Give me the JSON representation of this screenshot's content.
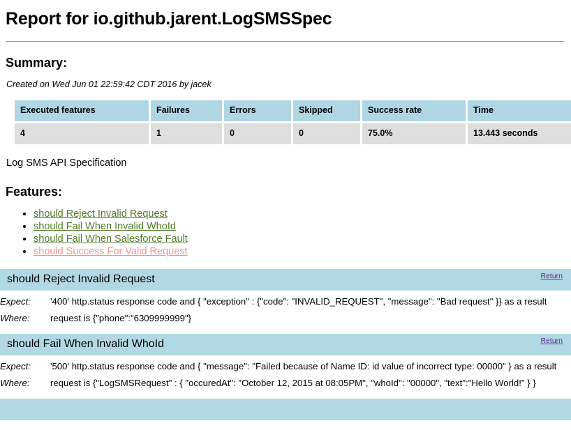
{
  "title": "Report for io.github.jarent.LogSMSSpec",
  "summary": {
    "heading": "Summary:",
    "created": "Created on Wed Jun 01 22:59:42 CDT 2016 by jacek",
    "table": {
      "headers": [
        "Executed features",
        "Failures",
        "Errors",
        "Skipped",
        "Success rate",
        "Time"
      ],
      "row": [
        "4",
        "1",
        "0",
        "0",
        "75.0%",
        "13.443 seconds"
      ]
    }
  },
  "spec_name": "Log SMS API Specification",
  "features": {
    "heading": "Features:",
    "items": [
      {
        "label": "should Reject Invalid Request",
        "status": "pass"
      },
      {
        "label": "should Fail When Invalid WhoId",
        "status": "pass"
      },
      {
        "label": "should Fail When Salesforce Fault",
        "status": "pass"
      },
      {
        "label": "should Success For Valid Request",
        "status": "fail"
      }
    ]
  },
  "return_label": "Return",
  "labels": {
    "expect": "Expect:",
    "where": "Where:"
  },
  "blocks": [
    {
      "title": "should Reject Invalid Request",
      "expect": "'400' http.status response code and { \"exception\" : {\"code\": \"INVALID_REQUEST\", \"message\": \"Bad request\" }} as a result",
      "where": "request is {\"phone\":\"6309999999\"}"
    },
    {
      "title": "should Fail When Invalid WhoId",
      "expect": "'500' http.status response code and { \"message\": \"Failed because of Name ID: id value of incorrect type: 00000\" } as a result",
      "where": "request is {\"LogSMSRequest\" : { \"occuredAt\": \"October 12, 2015 at 08:05PM\", \"whoId\": \"00000\", \"text\":\"Hello World!\" } }"
    },
    {
      "title": "",
      "expect": "",
      "where": ""
    }
  ],
  "colors": {
    "table_header_bg": "#aed6e3",
    "table_row_bg": "#dedede",
    "block_header_bg": "#b2d8e3",
    "pass_link": "#4f7a25",
    "fail_link": "#f4928d",
    "return_link": "#5b2d8e"
  }
}
